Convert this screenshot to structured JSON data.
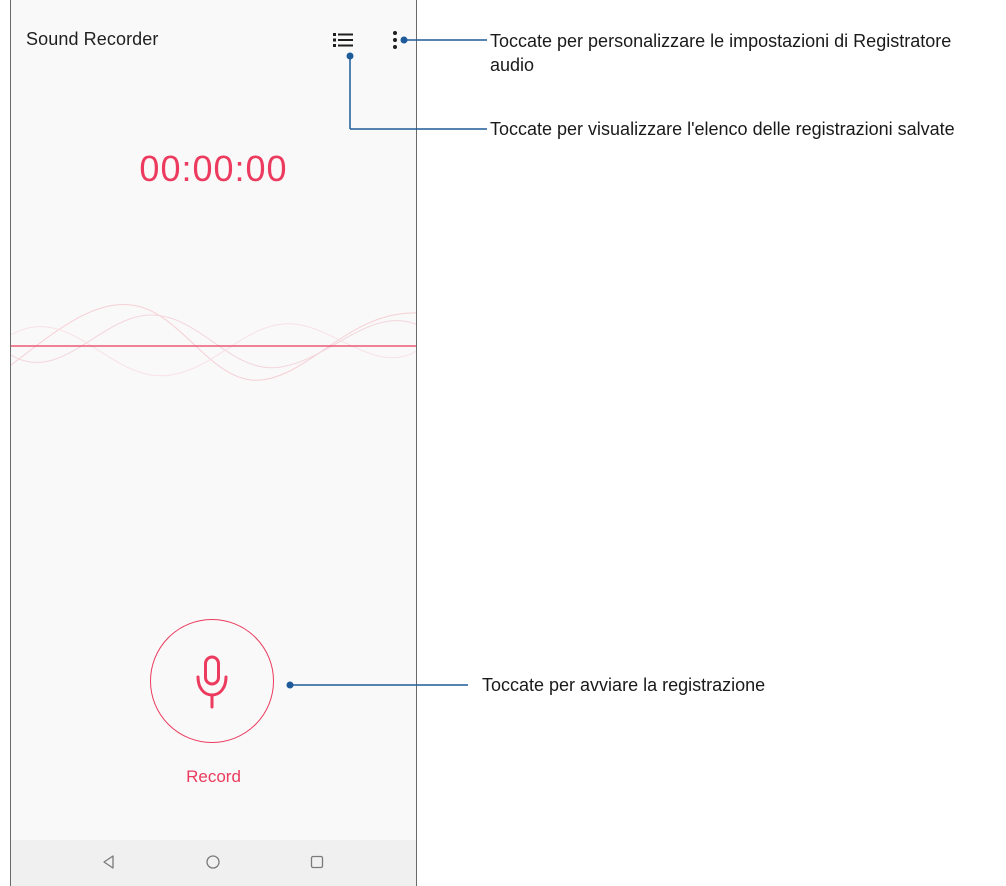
{
  "app": {
    "title": "Sound Recorder"
  },
  "toolbar": {
    "list_icon": "list-icon",
    "more_icon": "more-vert-icon"
  },
  "timer": "00:00:00",
  "record": {
    "label": "Record",
    "icon": "mic-icon"
  },
  "navbar": {
    "back_icon": "back-triangle-icon",
    "home_icon": "home-circle-icon",
    "recents_icon": "recents-square-icon"
  },
  "callouts": {
    "settings": "Toccate per personalizzare le impostazioni di Registratore audio",
    "list": "Toccate per visualizzare l'elenco delle registrazioni salvate",
    "record": "Toccate per avviare la registrazione"
  },
  "colors": {
    "accent": "#ec3b5e",
    "callout_line": "#1f5a99"
  }
}
